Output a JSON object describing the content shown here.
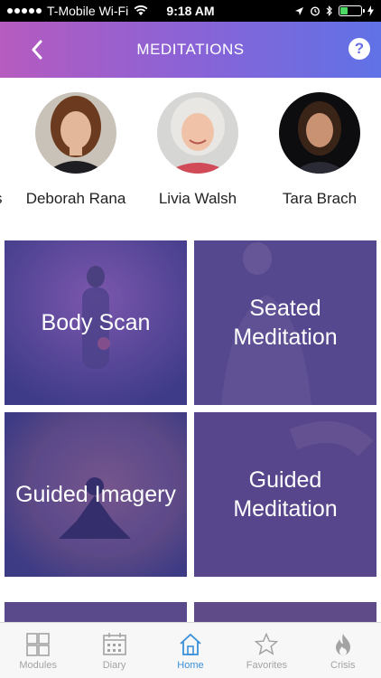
{
  "status": {
    "carrier": "T-Mobile Wi-Fi",
    "time": "9:18 AM",
    "battery_level": 0.35,
    "battery_color": "#4cd964"
  },
  "header": {
    "title": "MEDITATIONS",
    "back_icon": "chevron-left-icon",
    "help_label": "?",
    "gradient": [
      "#b65bbf",
      "#8a63d6",
      "#5f72e6"
    ]
  },
  "teachers": {
    "partial_label": "s",
    "items": [
      {
        "name": "Deborah Rana"
      },
      {
        "name": "Livia Walsh"
      },
      {
        "name": "Tara Brach"
      }
    ]
  },
  "cards": [
    {
      "label": "Body Scan"
    },
    {
      "label": "Seated\nMeditation"
    },
    {
      "label": "Guided Imagery"
    },
    {
      "label": "Guided\nMeditation"
    }
  ],
  "tabs": [
    {
      "label": "Modules",
      "icon": "grid-icon",
      "active": false
    },
    {
      "label": "Diary",
      "icon": "calendar-icon",
      "active": false
    },
    {
      "label": "Home",
      "icon": "home-icon",
      "active": true
    },
    {
      "label": "Favorites",
      "icon": "star-icon",
      "active": false
    },
    {
      "label": "Crisis",
      "icon": "flame-icon",
      "active": false
    }
  ],
  "colors": {
    "accent": "#3a8fd9",
    "inactive_tab": "#a3a3a3",
    "card_overlay": "#4b3f8f"
  }
}
